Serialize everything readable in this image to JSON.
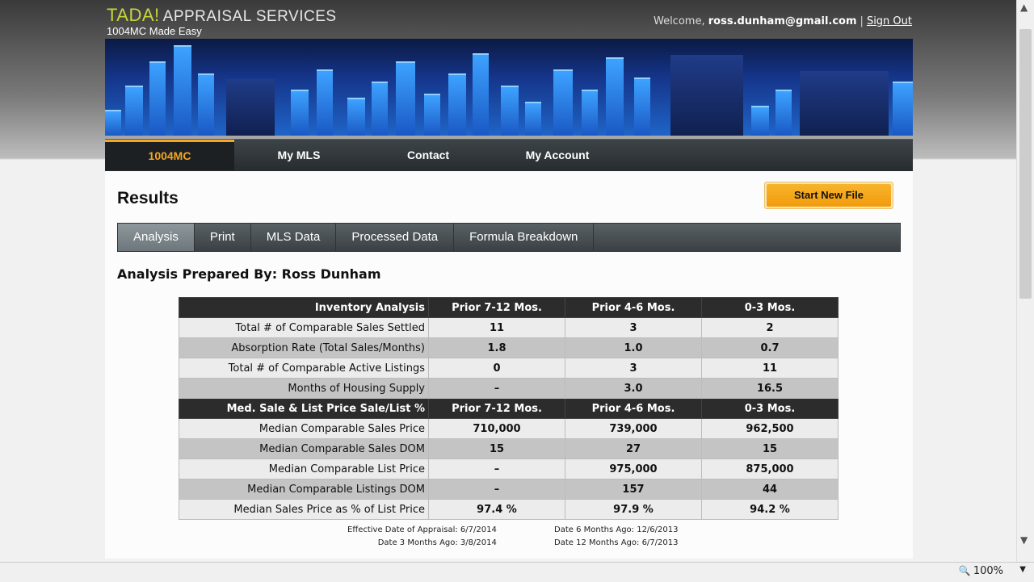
{
  "header": {
    "brand_tada": "TADA!",
    "brand_name": "APPRAISAL SERVICES",
    "brand_tagline": "1004MC Made Easy",
    "welcome_label": "Welcome,",
    "user_email": "ross.dunham@gmail.com",
    "separator": "|",
    "sign_out": "Sign Out"
  },
  "nav": {
    "items": [
      "1004MC",
      "My MLS",
      "Contact",
      "My Account"
    ],
    "active": "1004MC"
  },
  "page": {
    "title": "Results",
    "start_button": "Start New File"
  },
  "tabs": {
    "items": [
      "Analysis",
      "Print",
      "MLS Data",
      "Processed Data",
      "Formula Breakdown"
    ],
    "active": "Analysis"
  },
  "prepared_by": "Analysis Prepared By: Ross Dunham",
  "inventory": {
    "header": [
      "Inventory Analysis",
      "Prior 7-12 Mos.",
      "Prior 4-6 Mos.",
      "0-3 Mos."
    ],
    "rows": [
      [
        "Total # of Comparable Sales Settled",
        "11",
        "3",
        "2"
      ],
      [
        "Absorption Rate (Total Sales/Months)",
        "1.8",
        "1.0",
        "0.7"
      ],
      [
        "Total # of Comparable Active Listings",
        "0",
        "3",
        "11"
      ],
      [
        "Months of Housing Supply",
        "–",
        "3.0",
        "16.5"
      ]
    ]
  },
  "median": {
    "header": [
      "Med. Sale & List Price Sale/List %",
      "Prior 7-12 Mos.",
      "Prior 4-6 Mos.",
      "0-3 Mos."
    ],
    "rows": [
      [
        "Median Comparable Sales Price",
        "710,000",
        "739,000",
        "962,500"
      ],
      [
        "Median Comparable Sales DOM",
        "15",
        "27",
        "15"
      ],
      [
        "Median Comparable List Price",
        "–",
        "975,000",
        "875,000"
      ],
      [
        "Median Comparable Listings DOM",
        "–",
        "157",
        "44"
      ],
      [
        "Median Sales Price as % of List Price",
        "97.4 %",
        "97.9 %",
        "94.2 %"
      ]
    ]
  },
  "dates": {
    "effective": "Effective Date of Appraisal: 6/7/2014",
    "three_months": "Date 3 Months Ago: 3/8/2014",
    "six_months": "Date 6 Months Ago: 12/6/2013",
    "twelve_months": "Date 12 Months Ago: 6/7/2013"
  },
  "statusbar": {
    "zoom": "100%"
  },
  "colors": {
    "accent": "#f5a623",
    "brand_green": "#c6d63a"
  }
}
